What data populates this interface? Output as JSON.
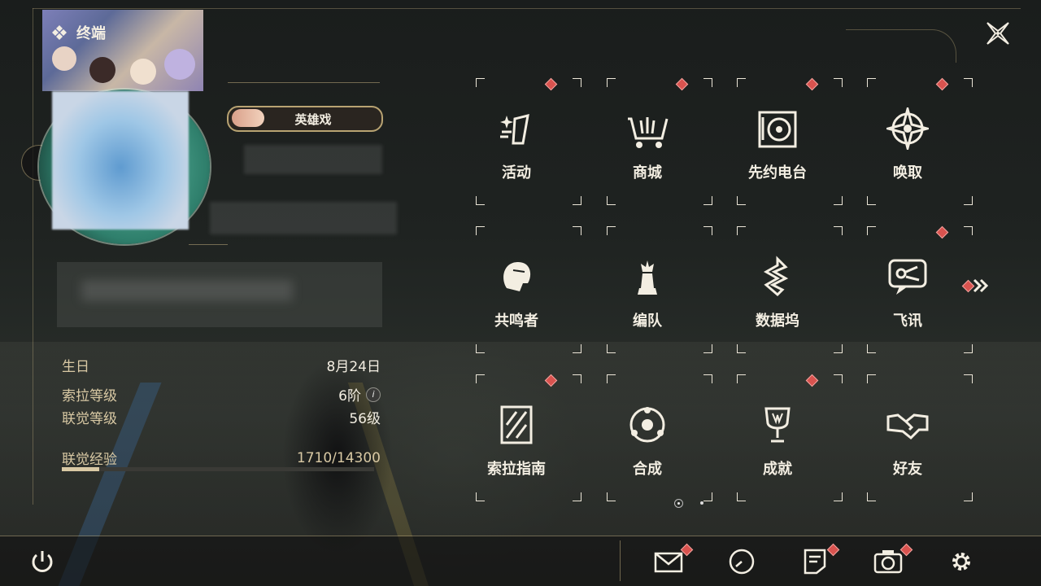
{
  "window": {
    "title": "终端"
  },
  "profile": {
    "badge": "英雄戏",
    "stats": [
      {
        "label": "生日",
        "value": "8月24日"
      },
      {
        "label": "索拉等级",
        "value": "6阶"
      },
      {
        "label": "联觉等级",
        "value": "56级"
      }
    ],
    "exp": {
      "label": "联觉经验",
      "value": "1710/14300",
      "fraction": 0.12
    },
    "info_glyph": "i"
  },
  "menu": {
    "items": [
      {
        "label": "活动",
        "icon": "event-icon",
        "badge": true
      },
      {
        "label": "商城",
        "icon": "shop-cart-icon",
        "badge": true
      },
      {
        "label": "先约电台",
        "icon": "radio-icon",
        "badge": true
      },
      {
        "label": "唤取",
        "icon": "gacha-compass-icon",
        "badge": true
      },
      {
        "label": "共鸣者",
        "icon": "resonator-icon",
        "badge": false
      },
      {
        "label": "编队",
        "icon": "chess-team-icon",
        "badge": false
      },
      {
        "label": "数据坞",
        "icon": "data-bank-icon",
        "badge": false
      },
      {
        "label": "飞讯",
        "icon": "message-bubble-icon",
        "badge": true
      },
      {
        "label": "索拉指南",
        "icon": "guide-book-icon",
        "badge": true
      },
      {
        "label": "合成",
        "icon": "synthesis-icon",
        "badge": false
      },
      {
        "label": "成就",
        "icon": "trophy-icon",
        "badge": true
      },
      {
        "label": "好友",
        "icon": "handshake-icon",
        "badge": false
      }
    ],
    "page": {
      "current": 1,
      "total": 2
    }
  },
  "footer": {
    "icons": [
      "power-icon",
      "mail-icon",
      "clock-icon",
      "notice-icon",
      "camera-icon",
      "settings-gear-icon"
    ]
  },
  "colors": {
    "accent": "#d9c9a4",
    "badge": "#d9534f",
    "text": "#f3eee2"
  }
}
